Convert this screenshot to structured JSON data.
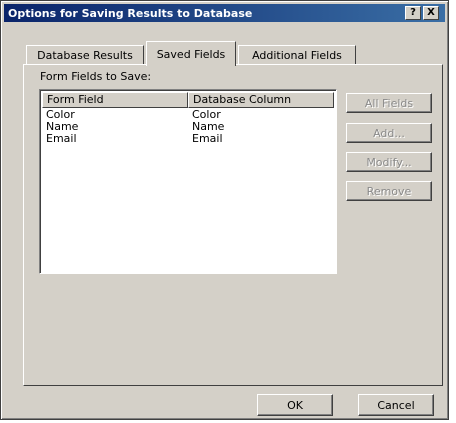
{
  "window": {
    "title": "Options for Saving Results to Database",
    "help_label": "?",
    "close_label": "X"
  },
  "tabs": [
    {
      "label": "Database Results"
    },
    {
      "label": "Saved Fields"
    },
    {
      "label": "Additional Fields"
    }
  ],
  "saved_fields": {
    "label": "Form Fields to Save:",
    "columns": [
      "Form Field",
      "Database Column"
    ],
    "rows": [
      [
        "Color",
        "Color"
      ],
      [
        "Name",
        "Name"
      ],
      [
        "Email",
        "Email"
      ]
    ],
    "buttons": {
      "all_fields": "All Fields",
      "add": "Add...",
      "modify": "Modify...",
      "remove": "Remove"
    }
  },
  "footer": {
    "ok": "OK",
    "cancel": "Cancel"
  }
}
